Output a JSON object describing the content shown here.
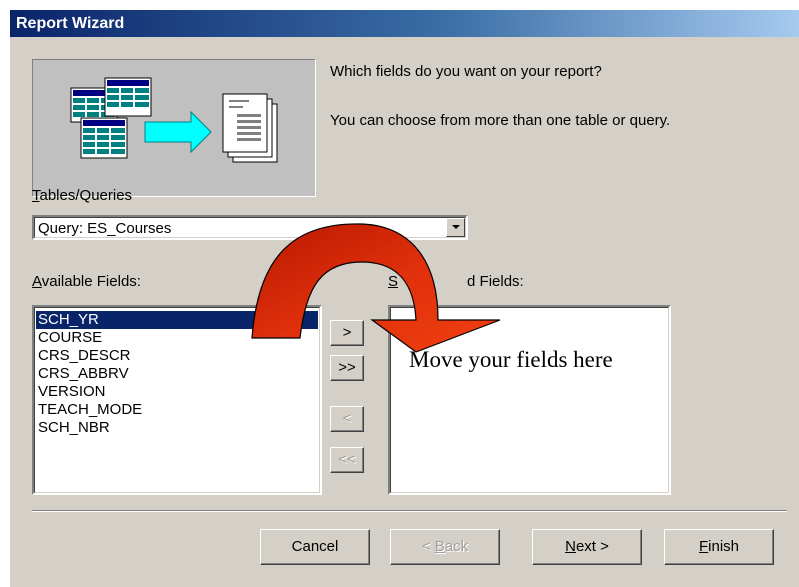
{
  "window": {
    "title": "Report Wizard"
  },
  "intro": {
    "question": "Which fields do you want on your report?",
    "hint": "You can choose from more than one table or query."
  },
  "tables_queries": {
    "label_accel": "T",
    "label_rest": "ables/Queries",
    "selected": "Query: ES_Courses"
  },
  "available_fields": {
    "label_accel": "A",
    "label_rest": "vailable Fields:",
    "items": [
      "SCH_YR",
      "COURSE",
      "CRS_DESCR",
      "CRS_ABBRV",
      "VERSION",
      "TEACH_MODE",
      "SCH_NBR"
    ],
    "selected_item": "SCH_YR"
  },
  "selected_fields": {
    "label_start": "S",
    "label_end": "d Fields:"
  },
  "move_buttons": {
    "add_one": ">",
    "add_all": ">>",
    "remove_one": "<",
    "remove_all": "<<"
  },
  "annotation": {
    "text": "Move your fields here",
    "arrow_color": "#d42a0a"
  },
  "footer": {
    "cancel": "Cancel",
    "back_prefix": "< ",
    "back_accel": "B",
    "back_rest": "ack",
    "next_accel": "N",
    "next_rest": "ext >",
    "finish_accel": "F",
    "finish_rest": "inish"
  },
  "icons": [
    "tables-icon",
    "arrow-right-icon",
    "report-pages-icon",
    "dropdown-arrow-icon",
    "curved-arrow-icon"
  ]
}
